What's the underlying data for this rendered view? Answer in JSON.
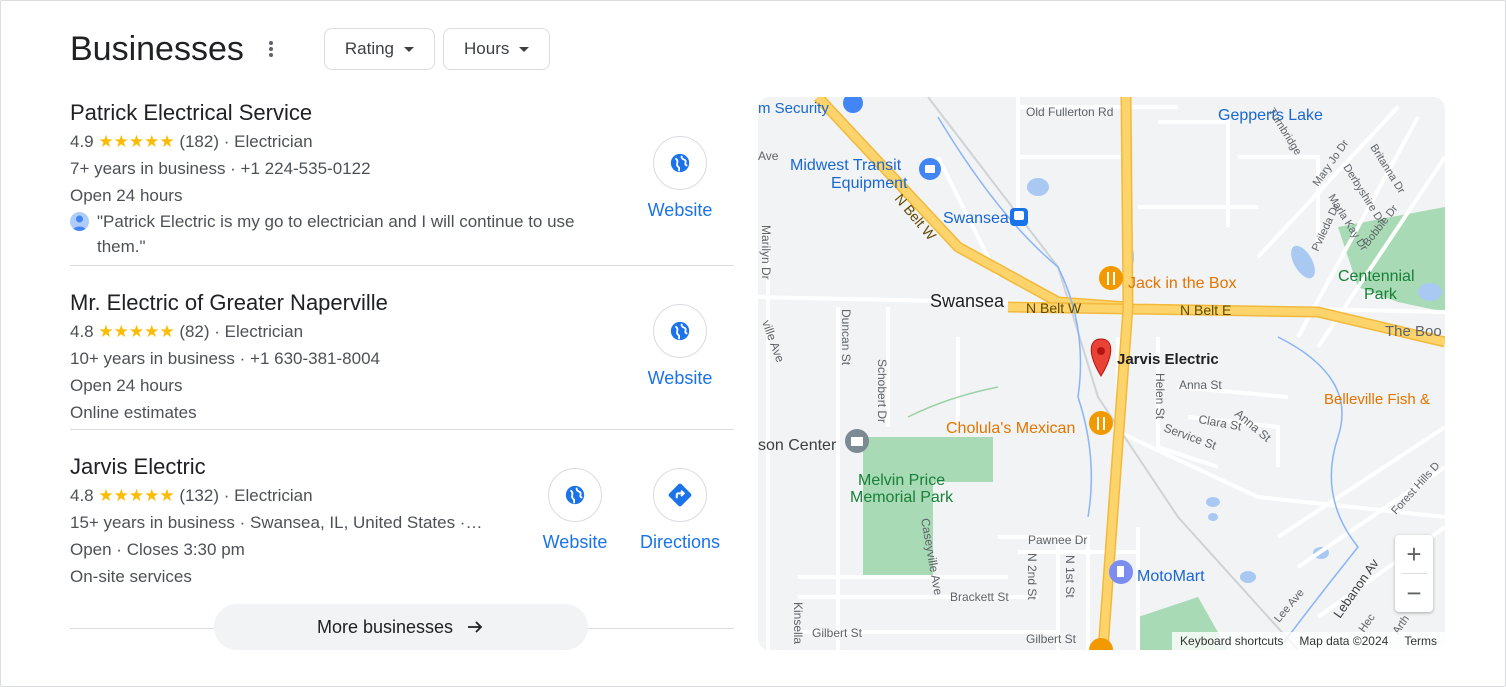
{
  "header": {
    "title": "Businesses",
    "filters": [
      {
        "label": "Rating"
      },
      {
        "label": "Hours"
      }
    ]
  },
  "businesses": [
    {
      "name": "Patrick Electrical Service",
      "rating": "4.9",
      "stars": "★★★★★",
      "reviews": "(182)",
      "category": "· Electrician",
      "info": "7+ years in business · +1 224-535-0122",
      "hours": "Open 24 hours",
      "review": "\"Patrick Electric is my go to electrician and I will continue to use them.\"",
      "actions": [
        {
          "label": "Website",
          "icon": "globe-icon"
        }
      ]
    },
    {
      "name": "Mr. Electric of Greater Naperville",
      "rating": "4.8",
      "stars": "★★★★★",
      "reviews": "(82)",
      "category": "· Electrician",
      "info": "10+ years in business · +1 630-381-8004",
      "hours": "Open 24 hours",
      "extra": "Online estimates",
      "actions": [
        {
          "label": "Website",
          "icon": "globe-icon"
        }
      ]
    },
    {
      "name": "Jarvis Electric",
      "rating": "4.8",
      "stars": "★★★★★",
      "reviews": "(132)",
      "category": "· Electrician",
      "info": "15+ years in business · Swansea, IL, United States ·…",
      "hours": "Open · Closes 3:30 pm",
      "extra": "On-site services",
      "actions": [
        {
          "label": "Website",
          "icon": "globe-icon"
        },
        {
          "label": "Directions",
          "icon": "directions-icon"
        }
      ]
    }
  ],
  "more_button": "More businesses",
  "map": {
    "labels": {
      "security": "m Security",
      "old_fullerton": "Old Fullerton Rd",
      "gepperts": "Gepperts Lake",
      "turnbridge": "Turnbridge",
      "britanna": "Britanna Dr",
      "mary_jo": "Mary Jo Dr",
      "derbyshire": "Derbyshire Dr",
      "marla_kay": "Marla Kay Dr",
      "bobbie": "Bobbie Dr",
      "pvileda": "Pvileda Dr",
      "ave": "Ave",
      "midwest1": "Midwest Transit",
      "midwest2": "Equipment",
      "n_belt_w_diag": "N Belt W",
      "swansea_station": "Swansea",
      "marilyn": "Marilyn Dr",
      "jack": "Jack in the Box",
      "centennial1": "Centennial",
      "centennial2": "Park",
      "swansea_town": "Swansea",
      "n_belt_w": "N Belt W",
      "n_belt_e": "N Belt E",
      "the_boo": "The Boo",
      "ville_ave": "ville Ave",
      "duncan": "Duncan St",
      "schobert": "Schobert Dr",
      "jarvis": "Jarvis Electric",
      "helen": "Helen St",
      "anna_st": "Anna St",
      "anna_st2": "Anna St",
      "clara": "Clara St",
      "belleville": "Belleville Fish &",
      "service": "Service St",
      "cholula": "Cholula's Mexican",
      "son_center": "son Center",
      "melvin1": "Melvin Price",
      "melvin2": "Memorial Park",
      "forest_hills": "Forest Hills D",
      "caseyville": "Caseyville Ave",
      "pawnee": "Pawnee Dr",
      "n2nd": "N 2nd St",
      "n1st": "N 1st St",
      "motomart": "MotoMart",
      "brackett": "Brackett St",
      "kinsella": "Kinsella",
      "gilbert1": "Gilbert St",
      "gilbert2": "Gilbert St",
      "lee": "Lee Ave",
      "lebanon": "Lebanon Av",
      "hec": "Hec",
      "arth": "Arth"
    },
    "zoom_in": "+",
    "zoom_out": "−",
    "attribution": {
      "shortcuts": "Keyboard shortcuts",
      "data": "Map data ©2024",
      "terms": "Terms"
    },
    "colors": {
      "highway": "#fcd46b",
      "highway_edge": "#f2b93b",
      "park": "#a8dab5",
      "water": "#a9c9f3",
      "pin": "#ea4335",
      "food": "#f29900",
      "transit": "#1a73e8"
    }
  }
}
